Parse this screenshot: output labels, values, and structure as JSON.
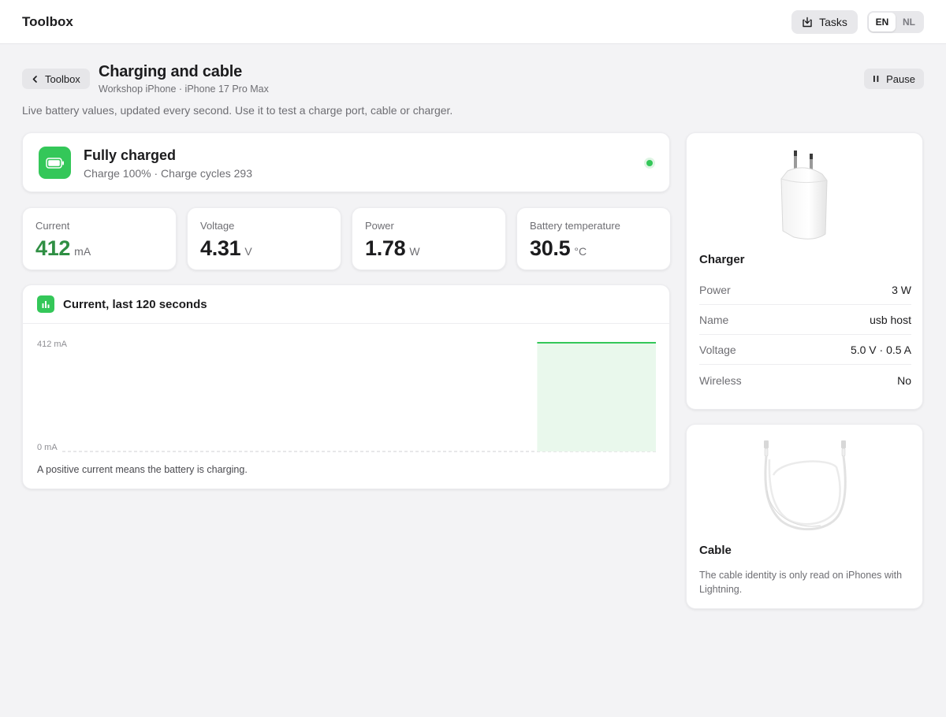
{
  "app": {
    "brand": "Toolbox",
    "tasks_label": "Tasks",
    "languages": [
      "EN",
      "NL"
    ],
    "active_language": "EN"
  },
  "header": {
    "back_label": "Toolbox",
    "title": "Charging and cable",
    "subtitle": "Workshop iPhone · iPhone 17 Pro Max",
    "pause_label": "Pause",
    "intro": "Live battery values, updated every second. Use it to test a charge port, cable or charger."
  },
  "status": {
    "title": "Fully charged",
    "subtitle": "Charge 100% · Charge cycles 293",
    "indicator_color": "#34c759"
  },
  "metrics": [
    {
      "label": "Current",
      "value": "412",
      "unit": "mA",
      "accent": "#2f8f43"
    },
    {
      "label": "Voltage",
      "value": "4.31",
      "unit": "V"
    },
    {
      "label": "Power",
      "value": "1.78",
      "unit": "W"
    },
    {
      "label": "Battery temperature",
      "value": "30.5",
      "unit": "°C"
    }
  ],
  "chart": {
    "title": "Current, last 120 seconds",
    "note": "A positive current means the battery is charging.",
    "icon": "bar-chart-icon"
  },
  "chart_data": {
    "type": "area",
    "title": "Current, last 120 seconds",
    "xlabel": "",
    "ylabel": "",
    "xlim": [
      0,
      120
    ],
    "ylim": [
      0,
      412
    ],
    "ytick_labels": [
      "412 mA",
      "0 mA"
    ],
    "yticks": [
      412,
      0
    ],
    "series": [
      {
        "color": "#34c759",
        "fill": "#e9f8ec",
        "x": [
          96,
          120
        ],
        "y": [
          412,
          412
        ]
      }
    ],
    "grid": false
  },
  "charger": {
    "title": "Charger",
    "rows": [
      {
        "key": "Power",
        "value": "3 W"
      },
      {
        "key": "Name",
        "value": "usb host"
      },
      {
        "key": "Voltage",
        "value": "5.0 V · 0.5 A"
      },
      {
        "key": "Wireless",
        "value": "No"
      }
    ]
  },
  "cable": {
    "title": "Cable",
    "note": "The cable identity is only read on iPhones with Lightning."
  }
}
